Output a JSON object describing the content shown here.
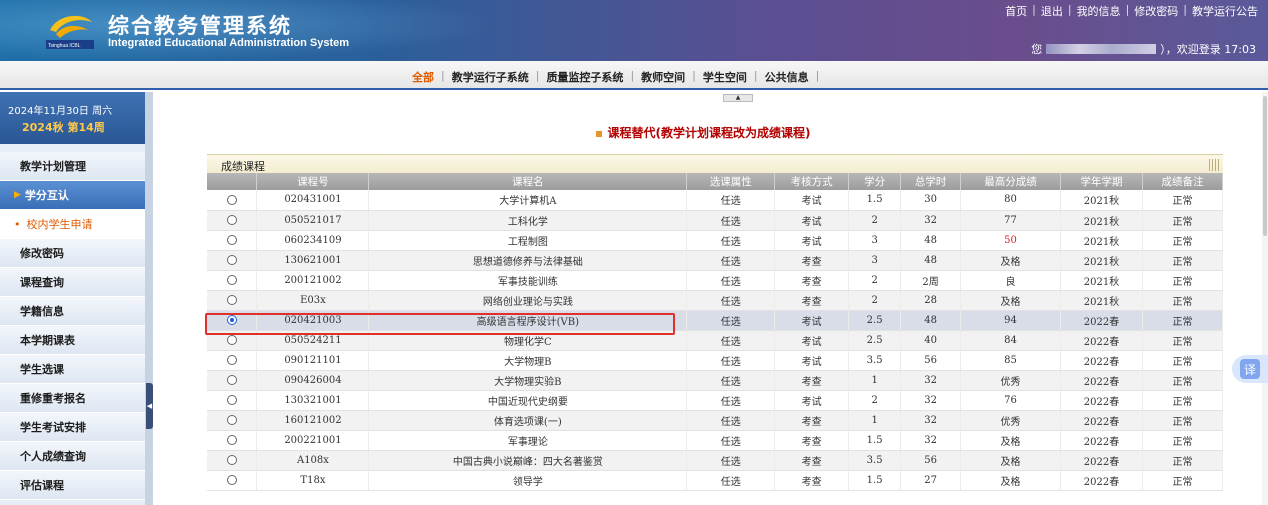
{
  "header": {
    "title": "综合教务管理系统",
    "subtitle": "Integrated Educational Administration System",
    "logo_text": "Tsinghua ICBL",
    "links": [
      "首页",
      "退出",
      "我的信息",
      "修改密码",
      "教学运行公告"
    ],
    "welcome_prefix": "您",
    "welcome_suffix": "），欢迎登录 17:03"
  },
  "nav": {
    "items": [
      "全部",
      "教学运行子系统",
      "质量监控子系统",
      "教师空间",
      "学生空间",
      "公共信息"
    ],
    "active_index": 0
  },
  "sidebar": {
    "date": "2024年11月30日  周六",
    "term": "2024秋 第14周",
    "menu": [
      {
        "label": "教学计划管理",
        "state": "normal"
      },
      {
        "label": "学分互认",
        "state": "selected"
      },
      {
        "label": "校内学生申请",
        "state": "sub"
      },
      {
        "label": "修改密码",
        "state": "normal"
      },
      {
        "label": "课程查询",
        "state": "normal"
      },
      {
        "label": "学籍信息",
        "state": "normal"
      },
      {
        "label": "本学期课表",
        "state": "normal"
      },
      {
        "label": "学生选课",
        "state": "normal"
      },
      {
        "label": "重修重考报名",
        "state": "normal"
      },
      {
        "label": "学生考试安排",
        "state": "normal"
      },
      {
        "label": "个人成绩查询",
        "state": "normal"
      },
      {
        "label": "评估课程",
        "state": "normal"
      }
    ]
  },
  "main": {
    "title": "课程替代(教学计划课程改为成绩课程)",
    "panel_title": "成绩课程",
    "columns": [
      "",
      "课程号",
      "课程名",
      "选课属性",
      "考核方式",
      "学分",
      "总学时",
      "最高分成绩",
      "学年学期",
      "成绩备注"
    ],
    "selected_row": 6,
    "rows": [
      {
        "code": "020431001",
        "name": "大学计算机A",
        "attr": "任选",
        "exam": "考试",
        "credit": "1.5",
        "hours": "30",
        "score": "80",
        "term": "2021秋",
        "note": "正常"
      },
      {
        "code": "050521017",
        "name": "工科化学",
        "attr": "任选",
        "exam": "考试",
        "credit": "2",
        "hours": "32",
        "score": "77",
        "term": "2021秋",
        "note": "正常"
      },
      {
        "code": "060234109",
        "name": "工程制图",
        "attr": "任选",
        "exam": "考试",
        "credit": "3",
        "hours": "48",
        "score": "50",
        "score_red": true,
        "term": "2021秋",
        "note": "正常"
      },
      {
        "code": "130621001",
        "name": "思想道德修养与法律基础",
        "attr": "任选",
        "exam": "考查",
        "credit": "3",
        "hours": "48",
        "score": "及格",
        "term": "2021秋",
        "note": "正常"
      },
      {
        "code": "200121002",
        "name": "军事技能训练",
        "attr": "任选",
        "exam": "考查",
        "credit": "2",
        "hours": "2周",
        "score": "良",
        "term": "2021秋",
        "note": "正常"
      },
      {
        "code": "E03x",
        "name": "网络创业理论与实践",
        "attr": "任选",
        "exam": "考查",
        "credit": "2",
        "hours": "28",
        "score": "及格",
        "term": "2021秋",
        "note": "正常"
      },
      {
        "code": "020421003",
        "name": "高级语言程序设计(VB)",
        "attr": "任选",
        "exam": "考试",
        "credit": "2.5",
        "hours": "48",
        "score": "94",
        "term": "2022春",
        "note": "正常"
      },
      {
        "code": "050524211",
        "name": "物理化学C",
        "attr": "任选",
        "exam": "考试",
        "credit": "2.5",
        "hours": "40",
        "score": "84",
        "term": "2022春",
        "note": "正常"
      },
      {
        "code": "090121101",
        "name": "大学物理B",
        "attr": "任选",
        "exam": "考试",
        "credit": "3.5",
        "hours": "56",
        "score": "85",
        "term": "2022春",
        "note": "正常"
      },
      {
        "code": "090426004",
        "name": "大学物理实验B",
        "attr": "任选",
        "exam": "考查",
        "credit": "1",
        "hours": "32",
        "score": "优秀",
        "term": "2022春",
        "note": "正常"
      },
      {
        "code": "130321001",
        "name": "中国近现代史纲要",
        "attr": "任选",
        "exam": "考试",
        "credit": "2",
        "hours": "32",
        "score": "76",
        "term": "2022春",
        "note": "正常"
      },
      {
        "code": "160121002",
        "name": "体育选项课(一)",
        "attr": "任选",
        "exam": "考查",
        "credit": "1",
        "hours": "32",
        "score": "优秀",
        "term": "2022春",
        "note": "正常"
      },
      {
        "code": "200221001",
        "name": "军事理论",
        "attr": "任选",
        "exam": "考查",
        "credit": "1.5",
        "hours": "32",
        "score": "及格",
        "term": "2022春",
        "note": "正常"
      },
      {
        "code": "A108x",
        "name": "中国古典小说巅峰：四大名著鉴赏",
        "attr": "任选",
        "exam": "考查",
        "credit": "3.5",
        "hours": "56",
        "score": "及格",
        "term": "2022春",
        "note": "正常"
      },
      {
        "code": "T18x",
        "name": "领导学",
        "attr": "任选",
        "exam": "考查",
        "credit": "1.5",
        "hours": "27",
        "score": "及格",
        "term": "2022春",
        "note": "正常"
      }
    ]
  },
  "translate_label": "译",
  "colors": {
    "accent_orange": "#e05a00",
    "title_red": "#b30000",
    "highlight_red": "#e0302a",
    "nav_blue": "#2f5fa8"
  }
}
